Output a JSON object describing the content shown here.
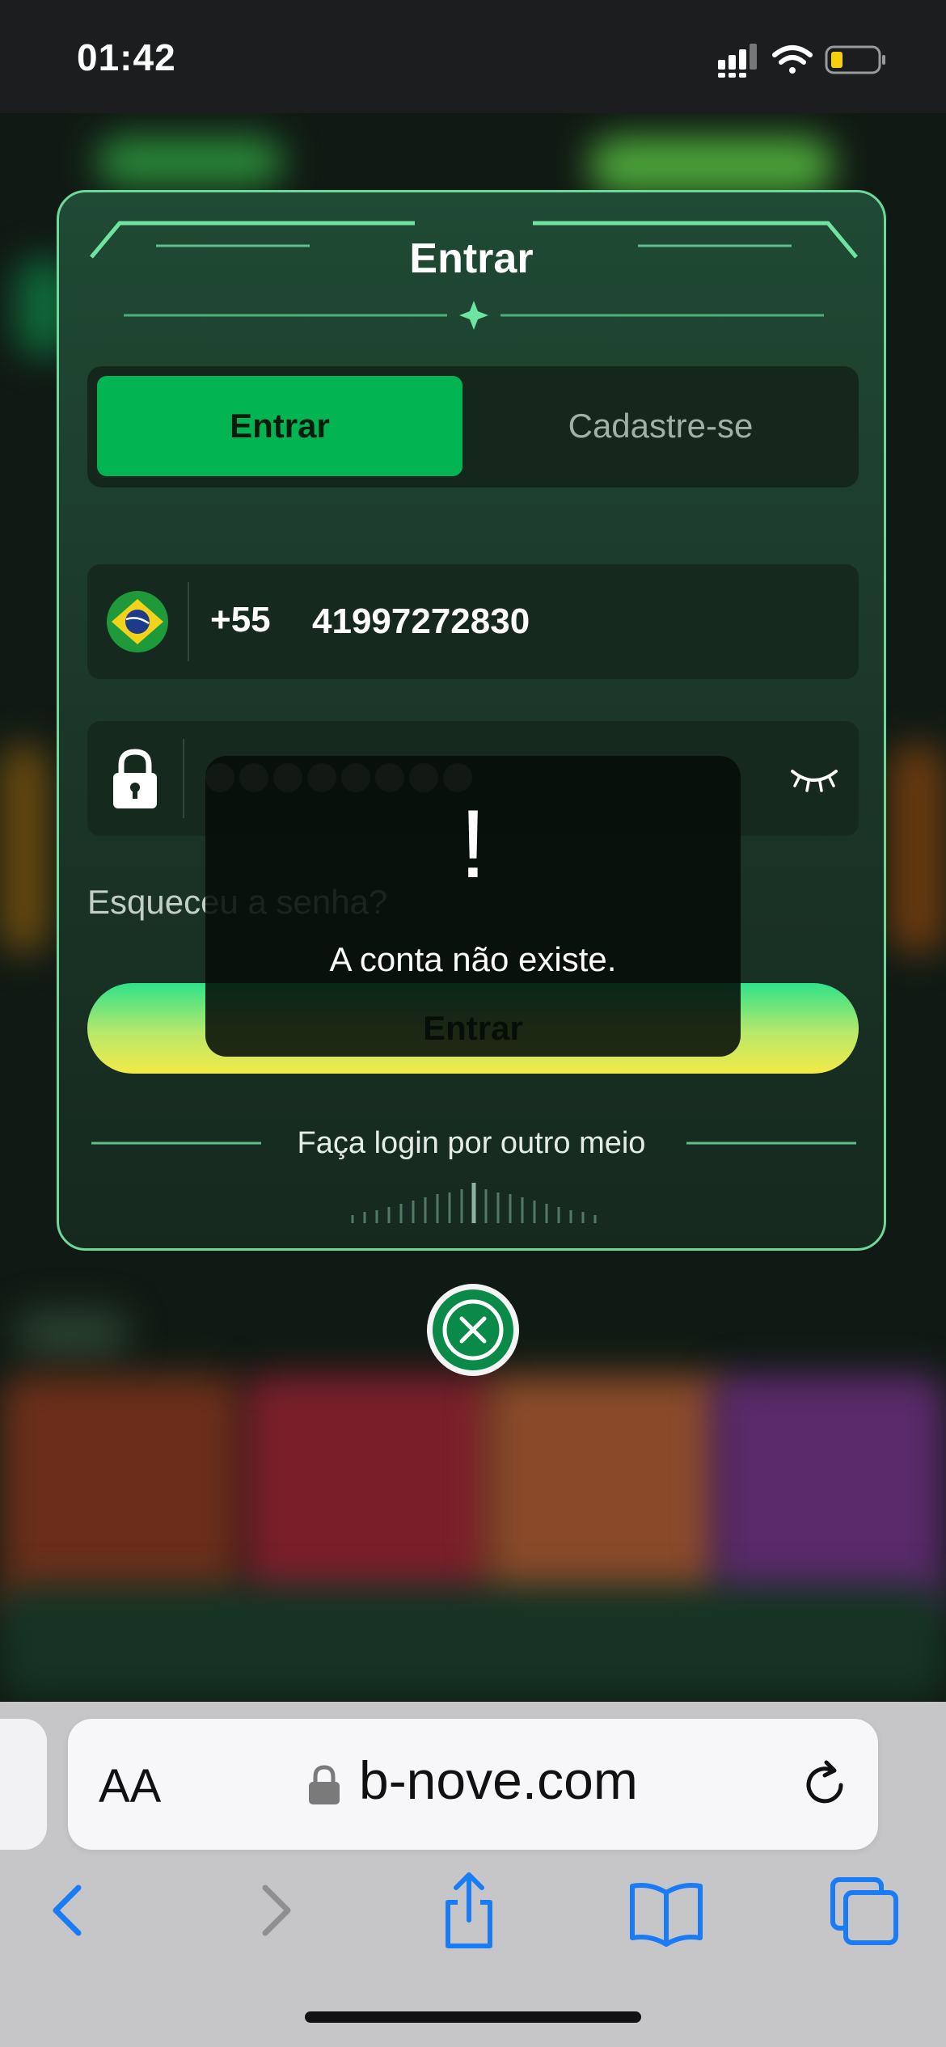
{
  "status_bar": {
    "time": "01:42"
  },
  "modal": {
    "title": "Entrar",
    "tabs": {
      "login": "Entrar",
      "register": "Cadastre-se"
    },
    "phone": {
      "country_code": "+55",
      "number": "41997272830"
    },
    "password": {
      "masked_length": 8
    },
    "forgot_password": "Esqueceu a senha?",
    "login_button": "Entrar",
    "other_login": "Faça login por outro meio"
  },
  "toast": {
    "icon_text": "!",
    "message": "A conta não existe."
  },
  "browser": {
    "text_size_label": "AA",
    "url": "b-nove.com"
  },
  "colors": {
    "accent_green": "#02b552",
    "modal_border": "#6fd79a",
    "browser_tint": "#1a7cf5"
  }
}
